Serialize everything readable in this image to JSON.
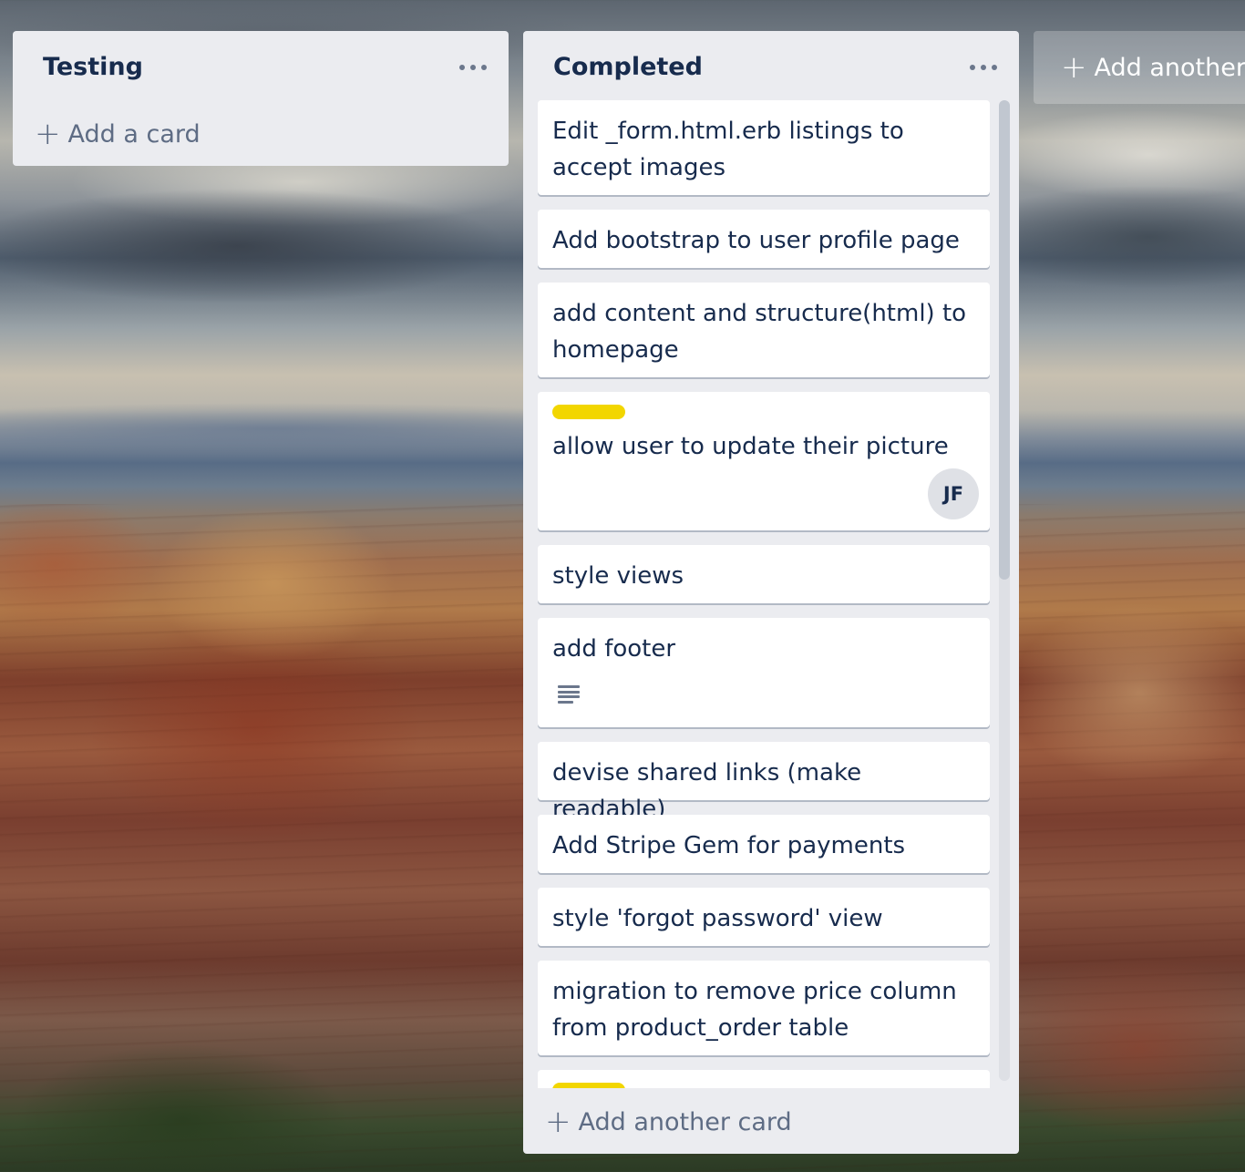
{
  "colors": {
    "list_bg": "#ebecf0",
    "card_bg": "#ffffff",
    "text": "#172b4d",
    "muted": "#5e6c84",
    "label_yellow": "#f2d600"
  },
  "lists": [
    {
      "title": "Testing",
      "menu_icon": "ellipsis-icon",
      "add_card_label": "Add a card"
    },
    {
      "title": "Completed",
      "menu_icon": "ellipsis-icon",
      "add_card_label": "Add another card",
      "cards": [
        {
          "text": "Edit _form.html.erb listings to accept images"
        },
        {
          "text": "Add bootstrap to user profile page"
        },
        {
          "text": "add content and structure(html) to homepage"
        },
        {
          "text": "allow user to update their picture",
          "label_color": "#f2d600",
          "member_initials": "JF"
        },
        {
          "text": "style views"
        },
        {
          "text": "add footer",
          "has_description": true,
          "badge_icon": "description-icon"
        },
        {
          "text": "devise shared links (make readable)"
        },
        {
          "text": "Add Stripe Gem for payments"
        },
        {
          "text": "style 'forgot password' view"
        },
        {
          "text": "migration to remove price column from product_order table"
        },
        {
          "text": "",
          "label_color": "#f2d600"
        }
      ]
    }
  ],
  "add_list_label": "Add another"
}
